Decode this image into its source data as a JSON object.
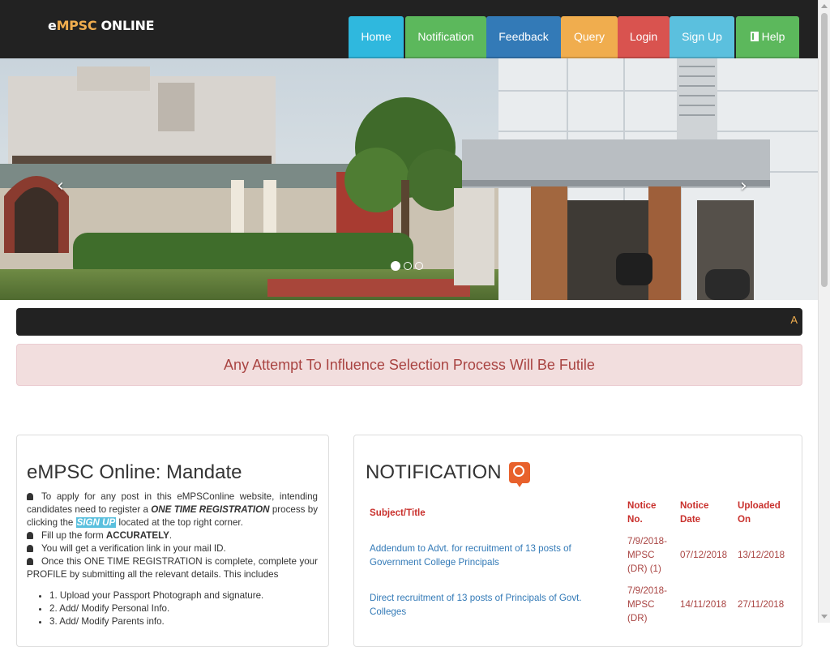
{
  "brand": {
    "logo_e": "e",
    "logo_mpsc": "MPSC",
    "logo_online": " ONLINE"
  },
  "nav": {
    "items": [
      {
        "label": "Home",
        "color": "#2fb8de"
      },
      {
        "label": "Notification",
        "color": "#5cb85c"
      },
      {
        "label": "Feedback",
        "color": "#337ab7"
      },
      {
        "label": "Query",
        "color": "#f0ad4e"
      },
      {
        "label": "Login",
        "color": "#d9534f"
      },
      {
        "label": "Sign Up",
        "color": "#5bc0de"
      },
      {
        "label": "Help",
        "color": "#5cb85c",
        "icon": "book-icon"
      }
    ]
  },
  "carousel": {
    "prev_label": "‹",
    "next_label": "›",
    "slide_count": 3,
    "active_slide": 1
  },
  "marquee": {
    "text": "A"
  },
  "alert": {
    "text": "Any Attempt To Influence Selection Process Will Be Futile"
  },
  "mandate": {
    "title": "eMPSC Online: Mandate",
    "p1_a": "To apply for any post in this eMPSConline website, intending candidates need to register a ",
    "p1_b": "ONE TIME REGISTRATION",
    "p1_c": " process by clicking the ",
    "p1_d": "SIGN UP",
    "p1_e": " located at the top right corner.",
    "p2_a": "Fill up the form ",
    "p2_b": "ACCURATELY",
    "p2_c": ".",
    "p3": "You will get a verification link in your mail ID.",
    "p4": "Once this ONE TIME REGISTRATION is complete, complete your PROFILE by submitting all the relevant details. This includes",
    "steps": [
      "1. Upload your Passport Photograph and signature.",
      "2. Add/ Modify Personal Info.",
      "3. Add/ Modify Parents info."
    ]
  },
  "notification": {
    "title": "NOTIFICATION",
    "headers": {
      "subject": "Subject/Title",
      "notice_no": "Notice No.",
      "notice_date": "Notice Date",
      "uploaded_on": "Uploaded On"
    },
    "rows": [
      {
        "subject": "Addendum to Advt. for recruitment of 13 posts of Government College Principals",
        "notice_no": "7/9/2018-MPSC (DR) (1)",
        "notice_date": "07/12/2018",
        "uploaded_on": "13/12/2018"
      },
      {
        "subject": "Direct recruitment of 13 posts of Principals of Govt. Colleges",
        "notice_no": "7/9/2018-MPSC (DR)",
        "notice_date": "14/11/2018",
        "uploaded_on": "27/11/2018"
      }
    ]
  }
}
